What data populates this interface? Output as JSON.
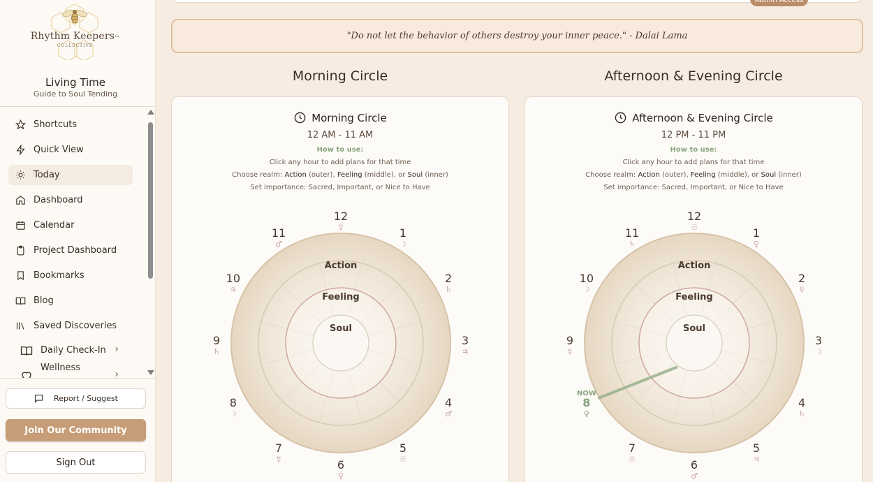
{
  "brand": {
    "name": "Rhythm Keepers",
    "sub": "COLLECTIVE",
    "tm": "™"
  },
  "app": {
    "title": "Living Time",
    "subtitle": "Guide to Soul Tending"
  },
  "nav": [
    {
      "label": "Shortcuts",
      "icon": "star-icon"
    },
    {
      "label": "Quick View",
      "icon": "lightning-icon"
    },
    {
      "label": "Today",
      "icon": "sun-icon",
      "active": true
    },
    {
      "label": "Dashboard",
      "icon": "home-icon"
    },
    {
      "label": "Calendar",
      "icon": "calendar-icon"
    },
    {
      "label": "Project Dashboard",
      "icon": "clipboard-icon"
    },
    {
      "label": "Bookmarks",
      "icon": "bookmark-icon"
    },
    {
      "label": "Blog",
      "icon": "open-book-icon"
    },
    {
      "label": "Saved Discoveries",
      "icon": "library-icon"
    }
  ],
  "nav_groups": [
    {
      "label": "Daily Check-In",
      "icon": "book-icon"
    },
    {
      "label": "Wellness",
      "icon": "heart-icon"
    }
  ],
  "footer": {
    "report": "Report / Suggest",
    "join": "Join Our Community",
    "signout": "Sign Out"
  },
  "admin_badge": "Admin Access",
  "quote": "\"Do not let the behavior of others destroy your inner peace.\" - Dalai Lama",
  "how_to": {
    "label": "How to use:",
    "line1": "Click any hour to add plans for that time",
    "choose_prefix": "Choose realm:",
    "action": "Action",
    "outer": "(outer),",
    "feeling": "Feeling",
    "middle": "(middle),",
    "or": "or",
    "soul": "Soul",
    "inner": "(inner)",
    "line3": "Set importance: Sacred, Important, or Nice to Have"
  },
  "realms": {
    "outer": "Action",
    "middle": "Feeling",
    "inner": "Soul"
  },
  "colors": {
    "accent": "#c79d77",
    "green": "#8aa47e",
    "ring": "#d9c6ad"
  },
  "circles": [
    {
      "heading": "Morning Circle",
      "title": "Morning Circle",
      "range": "12 AM - 11 AM",
      "hours": [
        {
          "n": "12",
          "s": "☿"
        },
        {
          "n": "1",
          "s": "☽"
        },
        {
          "n": "2",
          "s": "♄"
        },
        {
          "n": "3",
          "s": "♃"
        },
        {
          "n": "4",
          "s": "♂"
        },
        {
          "n": "5",
          "s": "☉"
        },
        {
          "n": "6",
          "s": "♀"
        },
        {
          "n": "7",
          "s": "☿"
        },
        {
          "n": "8",
          "s": "☽"
        },
        {
          "n": "9",
          "s": "♄"
        },
        {
          "n": "10",
          "s": "♃"
        },
        {
          "n": "11",
          "s": "♂"
        }
      ],
      "now": null
    },
    {
      "heading": "Afternoon & Evening Circle",
      "title": "Afternoon & Evening Circle",
      "range": "12 PM - 11 PM",
      "hours": [
        {
          "n": "12",
          "s": "☉"
        },
        {
          "n": "1",
          "s": "♀"
        },
        {
          "n": "2",
          "s": "☿"
        },
        {
          "n": "3",
          "s": "☽"
        },
        {
          "n": "4",
          "s": "♄"
        },
        {
          "n": "5",
          "s": "♃"
        },
        {
          "n": "6",
          "s": "♂"
        },
        {
          "n": "7",
          "s": "☉"
        },
        {
          "n": "8",
          "s": "♀"
        },
        {
          "n": "9",
          "s": "☿"
        },
        {
          "n": "10",
          "s": "☽"
        },
        {
          "n": "11",
          "s": "♄"
        }
      ],
      "now": {
        "label": "NOW",
        "hour": "8",
        "index": 8,
        "minute_fraction": 0.0
      }
    }
  ]
}
